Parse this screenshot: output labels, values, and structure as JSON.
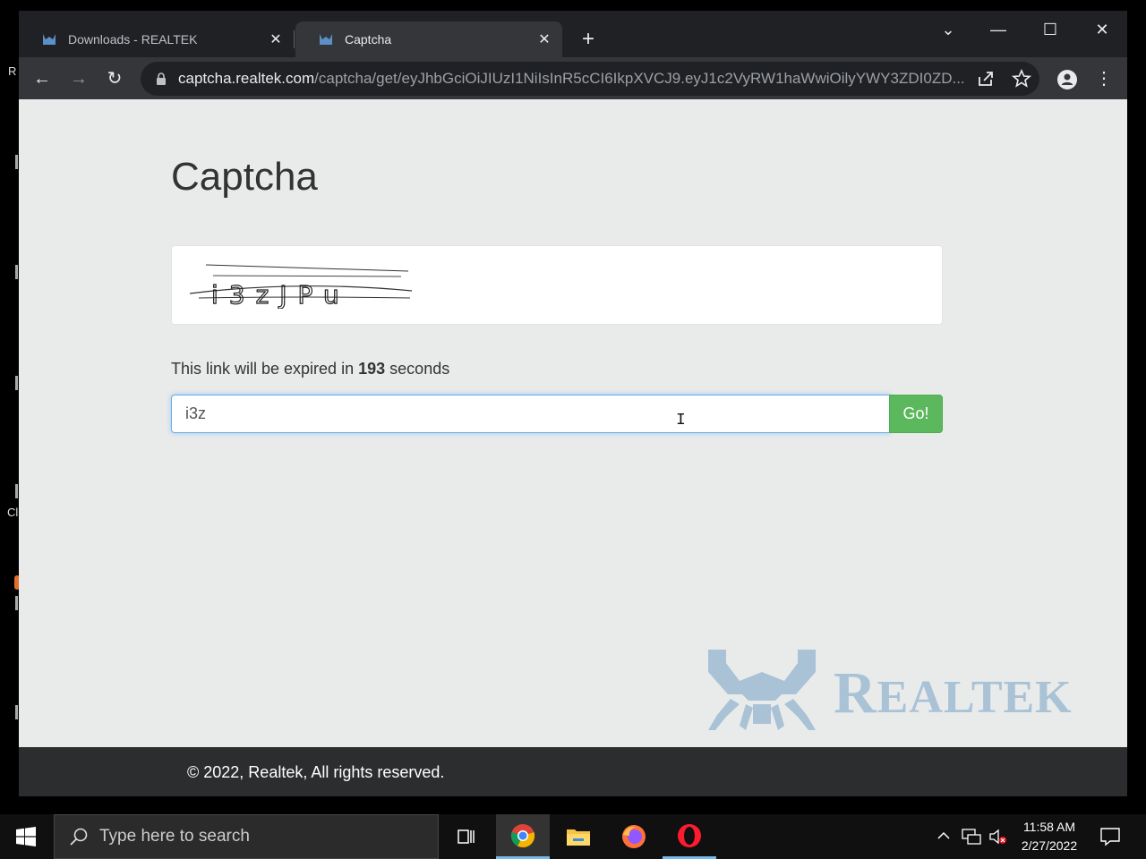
{
  "desktop": {
    "glyph_1": "R",
    "glyph_2": "Cl"
  },
  "browser": {
    "tabs": [
      {
        "title": "Downloads - REALTEK",
        "close": "✕"
      },
      {
        "title": "Captcha",
        "close": "✕"
      }
    ],
    "new_tab": "+",
    "window_controls": {
      "tab_search": "⌄",
      "minimize": "—",
      "maximize": "☐",
      "close": "✕"
    },
    "toolbar": {
      "back": "←",
      "forward": "→",
      "reload": "↻"
    },
    "url_host": "captcha.realtek.com",
    "url_path": "/captcha/get/eyJhbGciOiJIUzI1NiIsInR5cCI6IkpXVCJ9.eyJ1c2VyRW1haWwiOilyYWY3ZDI0ZD...",
    "menu": "⋮"
  },
  "page": {
    "title": "Captcha",
    "captcha_text": "i3zJPu",
    "expiry_prefix": "This link will be expired in",
    "expiry_seconds": "193",
    "expiry_suffix": "seconds",
    "input_value": "i3z",
    "go_label": "Go!",
    "logo_text_big": "R",
    "logo_text_rest": "EALTEK",
    "footer": "© 2022, Realtek, All rights reserved."
  },
  "taskbar": {
    "search_placeholder": "Type here to search",
    "time": "11:58 AM",
    "date": "2/27/2022"
  },
  "colors": {
    "go_button": "#5cb85c",
    "page_bg": "#e9ebeb",
    "logo": "#a9c2d6",
    "footer_bg": "#2b2d2f"
  }
}
